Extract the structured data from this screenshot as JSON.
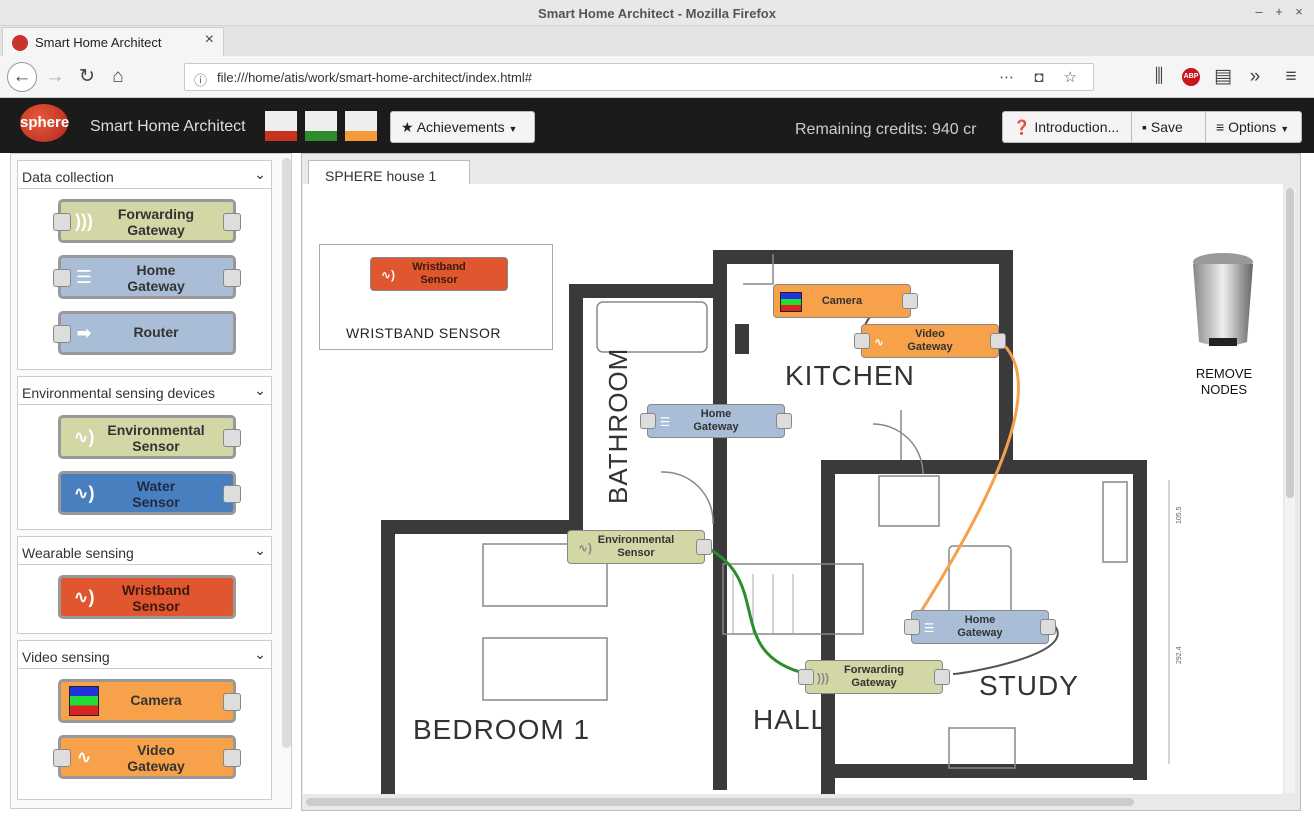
{
  "browser": {
    "window_title": "Smart Home Architect - Mozilla Firefox",
    "tab_title": "Smart Home Architect",
    "url": "file:///home/atis/work/smart-home-architect/index.html#",
    "abp_label": "ABP"
  },
  "app": {
    "logo_text": "sphere",
    "title": "Smart Home Architect",
    "achievements_label": "Achievements",
    "credits_label": "Remaining credits: 940 cr",
    "introduction_label": "Introduction...",
    "save_label": "Save",
    "options_label": "Options",
    "swatch_colors": [
      "#c8331f",
      "#2e8b2e",
      "#f59a3a"
    ]
  },
  "sidebar": {
    "sections": [
      {
        "title": "Data collection",
        "items": [
          {
            "label1": "Forwarding",
            "label2": "Gateway",
            "color": "#d3d6a5",
            "icon": "signal-icon"
          },
          {
            "label1": "Home",
            "label2": "Gateway",
            "color": "#a9bdd6",
            "icon": "database-icon"
          },
          {
            "label1": "Router",
            "label2": "",
            "color": "#a9bdd6",
            "icon": "arrow-right-icon"
          }
        ]
      },
      {
        "title": "Environmental sensing devices",
        "items": [
          {
            "label1": "Environmental",
            "label2": "Sensor",
            "color": "#d3d6a5",
            "icon": "pulse-icon"
          },
          {
            "label1": "Water",
            "label2": "Sensor",
            "color": "#4a7fbf",
            "icon": "pulse-icon"
          }
        ]
      },
      {
        "title": "Wearable sensing",
        "items": [
          {
            "label1": "Wristband",
            "label2": "Sensor",
            "color": "#e0562f",
            "icon": "pulse-icon"
          }
        ]
      },
      {
        "title": "Video sensing",
        "items": [
          {
            "label1": "Camera",
            "label2": "",
            "color": "#f7a24a",
            "icon": "camera-icon"
          },
          {
            "label1": "Video",
            "label2": "Gateway",
            "color": "#f7a24a",
            "icon": "wave-icon"
          }
        ]
      }
    ]
  },
  "workspace": {
    "tab_label": "SPHERE house 1",
    "legend_label": "WRISTBAND SENSOR",
    "remove_label_1": "REMOVE",
    "remove_label_2": "NODES",
    "rooms": {
      "kitchen": "KITCHEN",
      "bathroom": "BATHROOM",
      "bedroom": "BEDROOM 1",
      "hall": "HALL",
      "study": "STUDY"
    },
    "dim_labels": [
      "105.5",
      "292.4"
    ],
    "nodes": {
      "wristband": {
        "l1": "Wristband",
        "l2": "Sensor",
        "color": "#e0562f"
      },
      "camera": {
        "l1": "Camera",
        "l2": "",
        "color": "#f7a24a"
      },
      "video_gateway": {
        "l1": "Video",
        "l2": "Gateway",
        "color": "#f7a24a"
      },
      "home_gateway_1": {
        "l1": "Home",
        "l2": "Gateway",
        "color": "#a9bdd6"
      },
      "env_sensor": {
        "l1": "Environmental",
        "l2": "Sensor",
        "color": "#d3d6a5"
      },
      "home_gateway_2": {
        "l1": "Home",
        "l2": "Gateway",
        "color": "#a9bdd6"
      },
      "fwd_gateway": {
        "l1": "Forwarding",
        "l2": "Gateway",
        "color": "#d3d6a5"
      }
    }
  }
}
